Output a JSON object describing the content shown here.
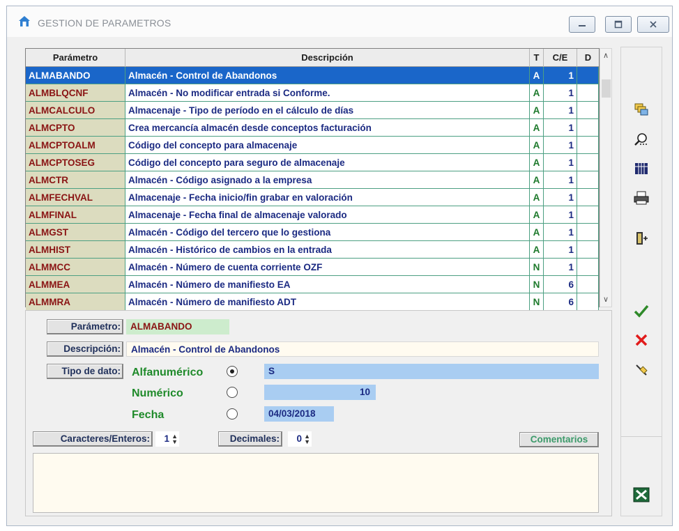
{
  "window": {
    "title": "GESTION DE PARAMETROS",
    "controls": [
      "minimize",
      "maximize",
      "close"
    ]
  },
  "grid": {
    "columns": [
      "Parámetro",
      "Descripción",
      "T",
      "C/E",
      "D"
    ],
    "rows": [
      {
        "param": "ALMABANDO",
        "desc": "Almacén - Control de Abandonos",
        "t": "A",
        "ce": "1",
        "d": "",
        "selected": true
      },
      {
        "param": "ALMBLQCNF",
        "desc": "Almacén - No modificar entrada si Conforme.",
        "t": "A",
        "ce": "1",
        "d": ""
      },
      {
        "param": "ALMCALCULO",
        "desc": "Almacenaje - Tipo de período en el cálculo de días",
        "t": "A",
        "ce": "1",
        "d": ""
      },
      {
        "param": "ALMCPTO",
        "desc": "Crea mercancía almacén desde conceptos facturación",
        "t": "A",
        "ce": "1",
        "d": ""
      },
      {
        "param": "ALMCPTOALM",
        "desc": "Código del concepto para almacenaje",
        "t": "A",
        "ce": "1",
        "d": ""
      },
      {
        "param": "ALMCPTOSEG",
        "desc": "Código del concepto para seguro de almacenaje",
        "t": "A",
        "ce": "1",
        "d": ""
      },
      {
        "param": "ALMCTR",
        "desc": "Almacén - Código asignado a la empresa",
        "t": "A",
        "ce": "1",
        "d": ""
      },
      {
        "param": "ALMFECHVAL",
        "desc": "Almacenaje - Fecha inicio/fin grabar en valoración",
        "t": "A",
        "ce": "1",
        "d": ""
      },
      {
        "param": "ALMFINAL",
        "desc": "Almacenaje - Fecha final de almacenaje valorado",
        "t": "A",
        "ce": "1",
        "d": ""
      },
      {
        "param": "ALMGST",
        "desc": "Almacén - Código del tercero que lo gestiona",
        "t": "A",
        "ce": "1",
        "d": ""
      },
      {
        "param": "ALMHIST",
        "desc": "Almacén - Histórico de cambios en la entrada",
        "t": "A",
        "ce": "1",
        "d": ""
      },
      {
        "param": "ALMMCC",
        "desc": "Almacén - Número de cuenta corriente OZF",
        "t": "N",
        "ce": "1",
        "d": ""
      },
      {
        "param": "ALMMEA",
        "desc": "Almacén - Número de manifiesto EA",
        "t": "N",
        "ce": "6",
        "d": ""
      },
      {
        "param": "ALMMRA",
        "desc": "Almacén - Número de manifiesto ADT",
        "t": "N",
        "ce": "6",
        "d": ""
      }
    ]
  },
  "detail": {
    "parametro_label": "Parámetro:",
    "parametro_value": "ALMABANDO",
    "descripcion_label": "Descripción:",
    "descripcion_value": "Almacén - Control de Abandonos",
    "tipo_label": "Tipo de dato:",
    "tipos": [
      {
        "label": "Alfanumérico",
        "value": "S",
        "checked": true
      },
      {
        "label": "Numérico",
        "value": "10",
        "checked": false
      },
      {
        "label": "Fecha",
        "value": "04/03/2018",
        "checked": false
      }
    ],
    "caracteres_label": "Caracteres/Enteros:",
    "caracteres_value": "1",
    "decimales_label": "Decimales:",
    "decimales_value": "0",
    "comentarios_label": "Comentarios",
    "comentarios_text": ""
  },
  "toolbar": {
    "icons": [
      "copy-records-icon",
      "search-icon",
      "table-view-icon",
      "print-icon",
      "exit-door-icon",
      "accept-check-icon",
      "cancel-x-icon",
      "clear-eraser-icon",
      "excel-export-icon"
    ]
  },
  "colors": {
    "selection": "#1a66c9",
    "param_cell": "#dcdcbf",
    "param_text": "#8a1414",
    "desc_text": "#1b2a82",
    "type_text": "#1e7a2c",
    "label_green": "#1f8a2a"
  }
}
